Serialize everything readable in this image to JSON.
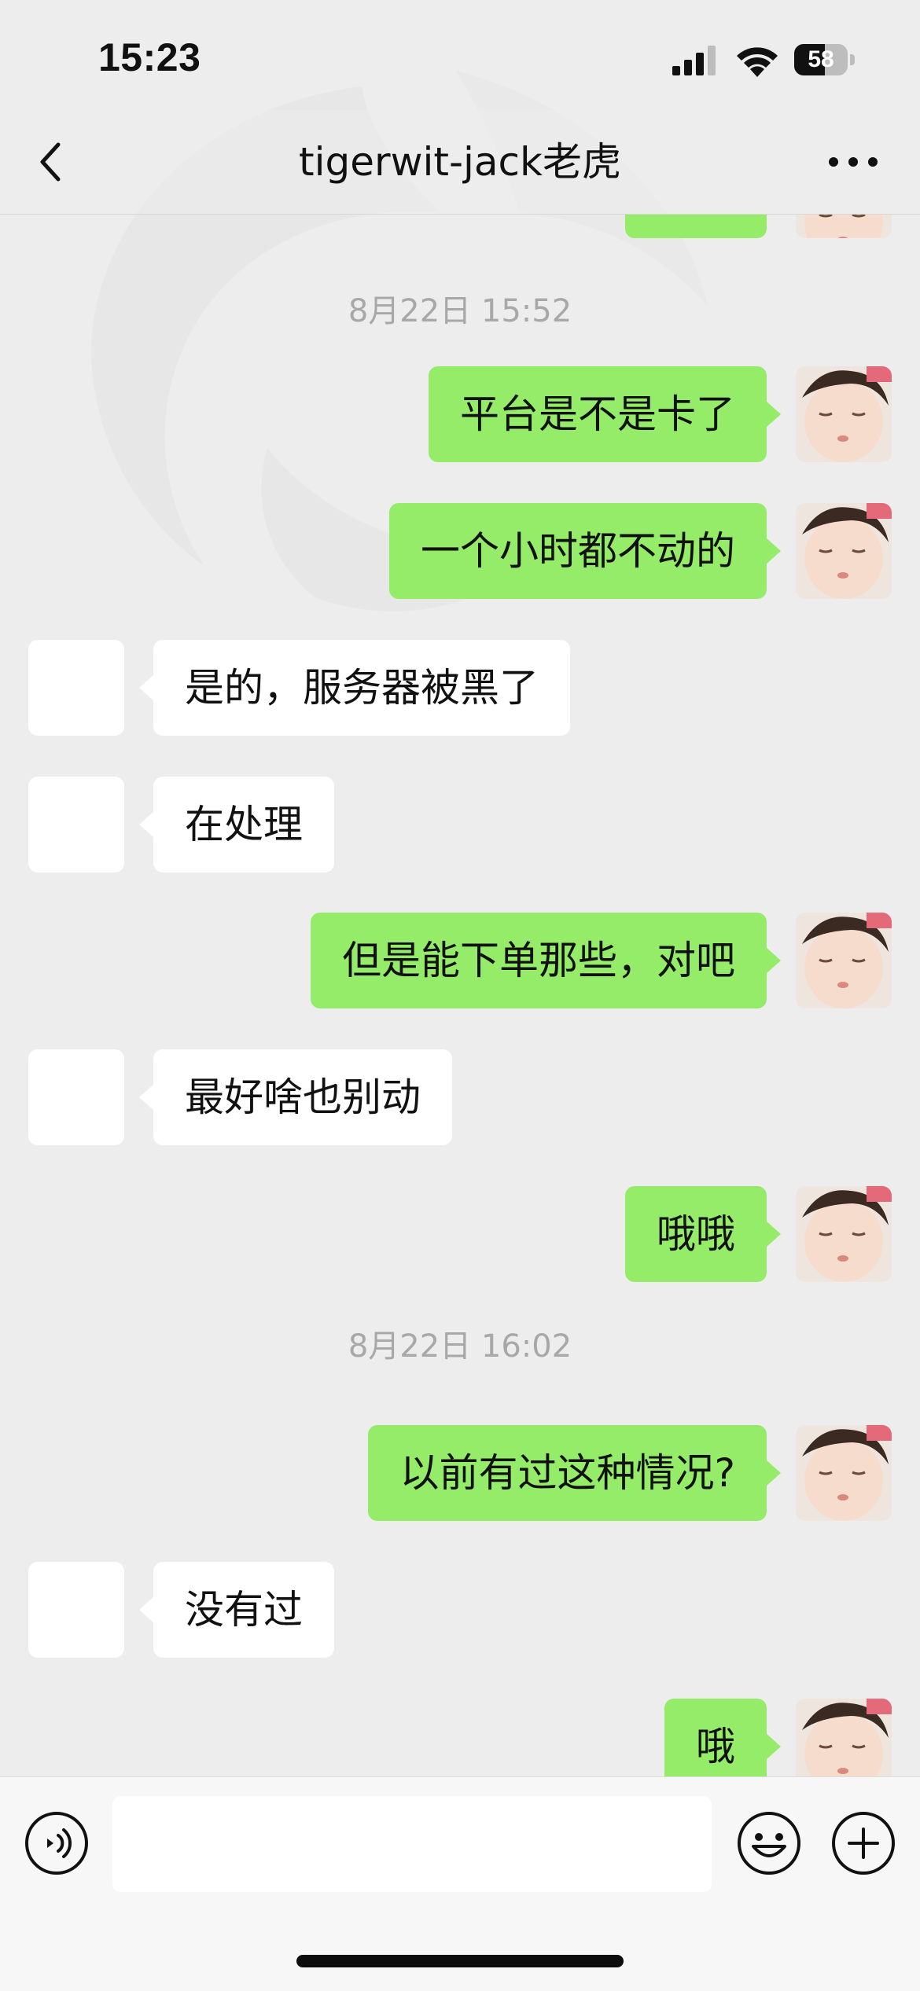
{
  "status_bar": {
    "time": "15:23",
    "battery_text": "58",
    "battery_level": 0.58
  },
  "nav": {
    "title": "tigerwit-jack老虎",
    "back_icon": "chevron-left-icon",
    "more_icon": "ellipsis-icon"
  },
  "messages": [
    {
      "type": "time",
      "text": "8月22日 15:52"
    },
    {
      "type": "msg",
      "side": "right",
      "text": "平台是不是卡了"
    },
    {
      "type": "msg",
      "side": "right",
      "text": "一个小时都不动的"
    },
    {
      "type": "msg",
      "side": "left",
      "text": "是的，服务器被黑了"
    },
    {
      "type": "msg",
      "side": "left",
      "text": "在处理"
    },
    {
      "type": "msg",
      "side": "right",
      "text": "但是能下单那些，对吧"
    },
    {
      "type": "msg",
      "side": "left",
      "text": "最好啥也别动"
    },
    {
      "type": "msg",
      "side": "right",
      "text": "哦哦"
    },
    {
      "type": "time",
      "text": "8月22日 16:02"
    },
    {
      "type": "msg",
      "side": "right",
      "text": "以前有过这种情况?"
    },
    {
      "type": "msg",
      "side": "left",
      "text": "没有过"
    },
    {
      "type": "msg",
      "side": "right",
      "text": "哦"
    }
  ],
  "input_bar": {
    "value": "",
    "voice_icon": "voice-icon",
    "emoji_icon": "emoji-icon",
    "plus_icon": "plus-icon"
  },
  "colors": {
    "background": "#ededed",
    "sent_bubble": "#95ec69",
    "received_bubble": "#ffffff",
    "timestamp": "#a8a8a8"
  }
}
